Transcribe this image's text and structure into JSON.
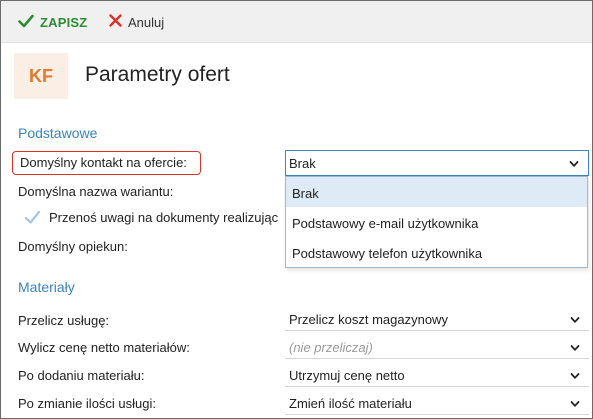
{
  "toolbar": {
    "save_label": "ZAPISZ",
    "cancel_label": "Anuluj"
  },
  "header": {
    "avatar_text": "KF",
    "title": "Parametry ofert"
  },
  "sections": {
    "basic": {
      "title": "Podstawowe",
      "default_contact_label": "Domyślny kontakt na ofercie:",
      "default_contact_value": "Brak",
      "default_variant_label": "Domyślna nazwa wariantu:",
      "transfer_notes_label": "Przenoś uwagi na dokumenty realizując",
      "default_guardian_label": "Domyślny opiekun:"
    },
    "materials": {
      "title": "Materiały",
      "rows": [
        {
          "label": "Przelicz usługę:",
          "value": "Przelicz koszt magazynowy"
        },
        {
          "label": "Wylicz cenę netto materiałów:",
          "value": "(nie przeliczaj)"
        },
        {
          "label": "Po dodaniu materiału:",
          "value": "Utrzymuj cenę netto"
        },
        {
          "label": "Po zmianie ilości usługi:",
          "value": "Zmień ilość materiału"
        }
      ]
    }
  },
  "dropdown": {
    "options": [
      "Brak",
      "Podstawowy e-mail użytkownika",
      "Podstawowy telefon użytkownika"
    ],
    "selected_index": 0
  },
  "icons": {
    "save": "check-icon",
    "cancel": "close-icon",
    "chevron": "chevron-down-icon",
    "checkbox": "checkmark-icon"
  },
  "colors": {
    "accent": "#3a84c1",
    "save_green": "#2e8b34",
    "cancel_red": "#d9342b",
    "avatar_bg": "#fbeee4",
    "avatar_fg": "#e07a2e"
  }
}
